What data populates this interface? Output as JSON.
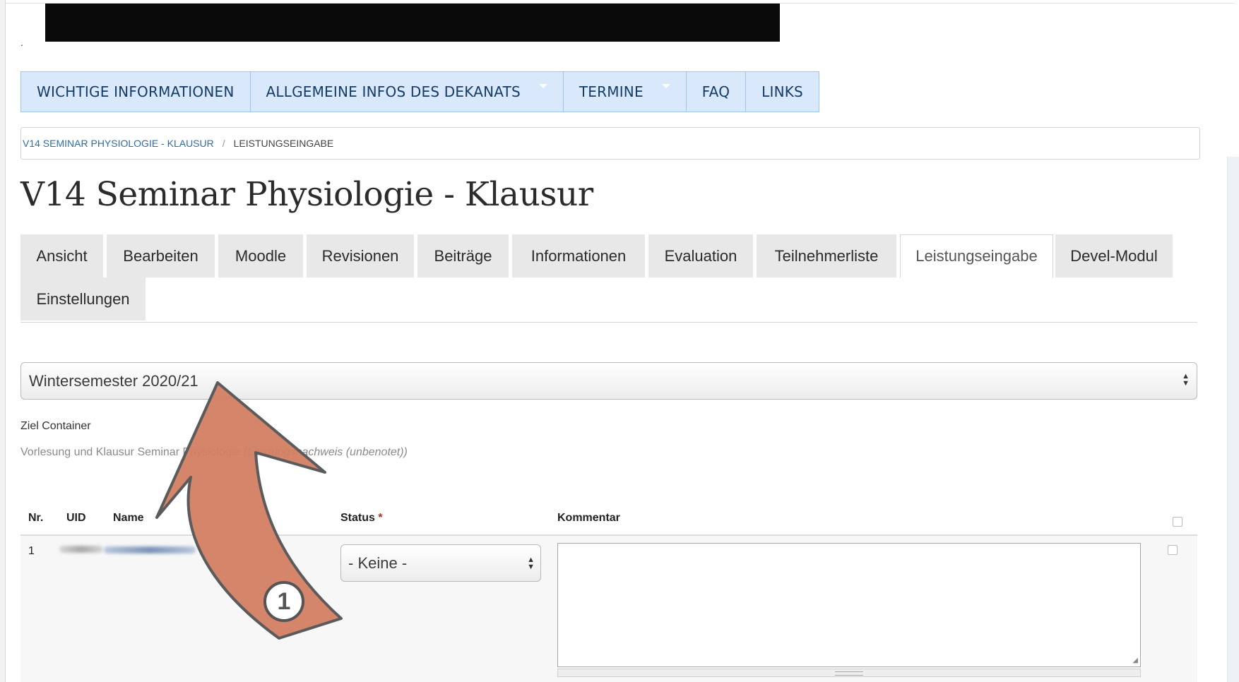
{
  "header": {
    "stray_dot": "."
  },
  "main_nav": [
    {
      "label": "WICHTIGE INFORMATIONEN",
      "has_dropdown": false
    },
    {
      "label": "ALLGEMEINE INFOS DES DEKANATS",
      "has_dropdown": true
    },
    {
      "label": "TERMINE",
      "has_dropdown": true
    },
    {
      "label": "FAQ",
      "has_dropdown": false
    },
    {
      "label": "LINKS",
      "has_dropdown": false
    }
  ],
  "breadcrumb": {
    "link": "V14 SEMINAR PHYSIOLOGIE - KLAUSUR",
    "separator": "/",
    "current": "LEISTUNGSEINGABE"
  },
  "page_title": "V14 Seminar Physiologie - Klausur",
  "tabs": {
    "items": [
      "Ansicht",
      "Bearbeiten",
      "Moodle",
      "Revisionen",
      "Beiträge",
      "Informationen",
      "Evaluation",
      "Teilnehmerliste",
      "Leistungseingabe",
      "Devel-Modul",
      "Einstellungen"
    ],
    "active": "Leistungseingabe"
  },
  "semester_select": {
    "value": "Wintersemester 2020/21",
    "arrows": "▲▼"
  },
  "target_container": {
    "label": "Ziel Container",
    "value": "Vorlesung und Klausur Seminar Physiologie",
    "value_type": "(Leistungsnachweis (unbenotet))"
  },
  "table": {
    "headers": {
      "nr": "Nr.",
      "uid": "UID",
      "name": "Name",
      "status": "Status",
      "status_required": "*",
      "comment": "Kommentar"
    },
    "rows": [
      {
        "nr": "1",
        "status": "- Keine -",
        "comment": ""
      }
    ]
  },
  "annotation": {
    "number": "1",
    "color": "#d27e62"
  },
  "colors": {
    "nav_bg": "#d9e9fb",
    "nav_text": "#143c66",
    "link": "#2f6da4",
    "required": "#d21f1f"
  }
}
